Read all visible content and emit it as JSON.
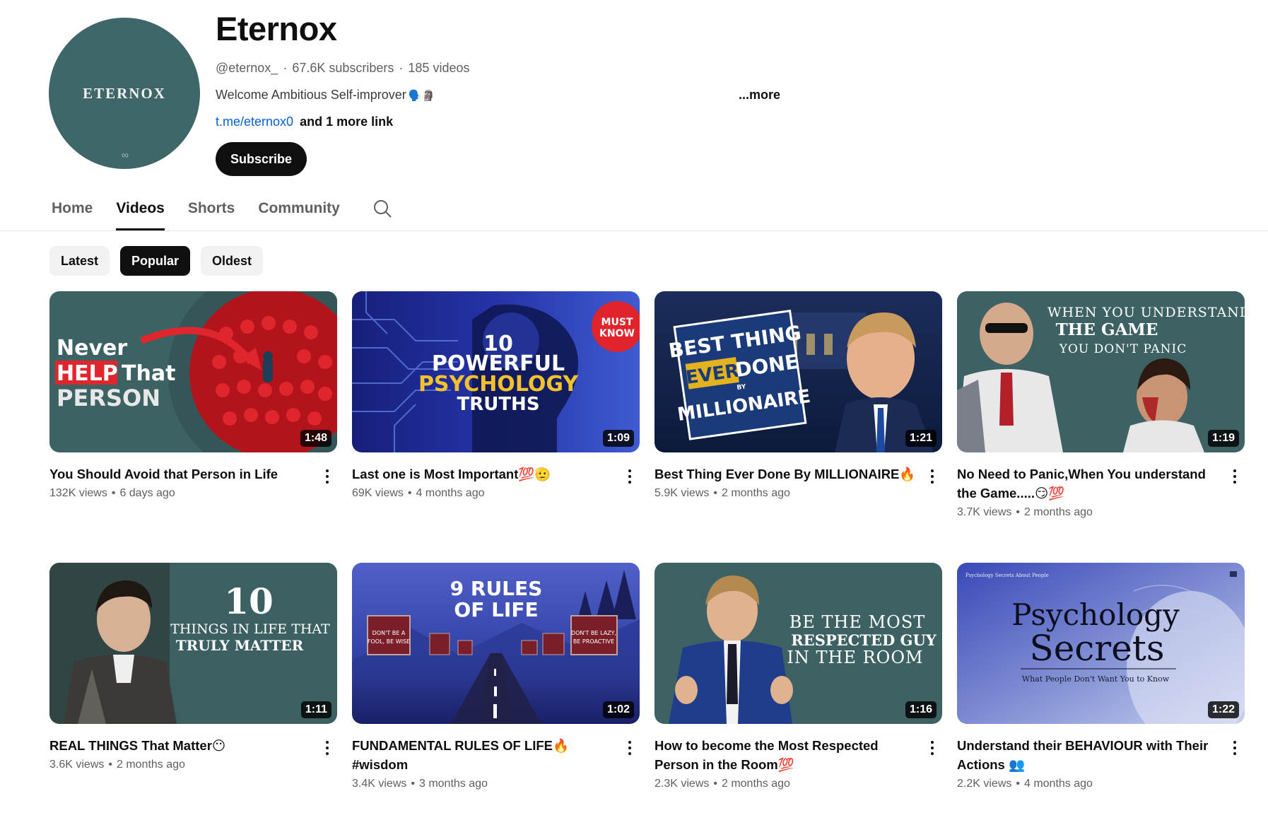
{
  "channel": {
    "avatar_text": "ETERNOX",
    "avatar_mark": "∞",
    "name": "Eternox",
    "handle": "@eternox_",
    "subscribers": "67.6K subscribers",
    "videos_count": "185 videos",
    "description": "Welcome Ambitious Self-improver",
    "description_emoji": "🗣️🗿",
    "more_label": "...more",
    "link": "t.me/eternox0",
    "more_links": "and 1 more link",
    "subscribe_label": "Subscribe"
  },
  "tabs": [
    {
      "label": "Home"
    },
    {
      "label": "Videos",
      "active": true
    },
    {
      "label": "Shorts"
    },
    {
      "label": "Community"
    }
  ],
  "chips": [
    {
      "label": "Latest"
    },
    {
      "label": "Popular",
      "active": true
    },
    {
      "label": "Oldest"
    }
  ],
  "videos": [
    {
      "title": "You Should Avoid that Person in Life",
      "views": "132K views",
      "age": "6 days ago",
      "duration": "1:48",
      "thumb": {
        "line1": "Never",
        "line2a": "HELP",
        "line2b": "That",
        "line3": "PERSON"
      }
    },
    {
      "title": "Last one is Most Important💯🫡",
      "views": "69K views",
      "age": "4 months ago",
      "duration": "1:09",
      "thumb": {
        "num": "10",
        "line1": "POWERFUL",
        "line2": "PSYCHOLOGY",
        "line3": "TRUTHS",
        "badge1": "MUST",
        "badge2": "KNOW"
      }
    },
    {
      "title": "Best Thing Ever Done By MILLIONAIRE🔥",
      "views": "5.9K views",
      "age": "2 months ago",
      "duration": "1:21",
      "thumb": {
        "line1": "BEST THING",
        "line2a": "EVER",
        "line2b": "DONE",
        "by": "BY",
        "line3": "MILLIONAIRE"
      }
    },
    {
      "title": "No Need to Panic,When You understand the Game.....😏💯",
      "views": "3.7K views",
      "age": "2 months ago",
      "duration": "1:19",
      "thumb": {
        "line1": "WHEN YOU UNDERSTAND",
        "line2": "THE GAME",
        "line3": "YOU DON'T PANIC"
      }
    },
    {
      "title": "REAL THINGS That Matter😶",
      "views": "3.6K views",
      "age": "2 months ago",
      "duration": "1:11",
      "thumb": {
        "num": "10",
        "line1": "THINGS IN LIFE THAT",
        "line2": "TRULY MATTER"
      }
    },
    {
      "title": "FUNDAMENTAL RULES OF LIFE🔥#wisdom",
      "views": "3.4K views",
      "age": "3 months ago",
      "duration": "1:02",
      "thumb": {
        "line1": "9 RULES",
        "line2": "OF LIFE",
        "sign1": "DON'T BE A FOOL, BE WISE",
        "sign2": "DON'T BE LAZY, BE PROACTIVE"
      }
    },
    {
      "title": "How to become the Most Respected Person in the Room💯",
      "views": "2.3K views",
      "age": "2 months ago",
      "duration": "1:16",
      "thumb": {
        "line1": "BE THE MOST",
        "line2": "RESPECTED GUY",
        "line3": "IN THE ROOM"
      }
    },
    {
      "title": "Understand their BEHAVIOUR with Their Actions 👥",
      "views": "2.2K views",
      "age": "4 months ago",
      "duration": "1:22",
      "thumb": {
        "top": "Psychology Secrets About People",
        "line1": "Psychology",
        "line2": "Secrets",
        "line3": "What People Don't Want You to Know"
      }
    }
  ]
}
